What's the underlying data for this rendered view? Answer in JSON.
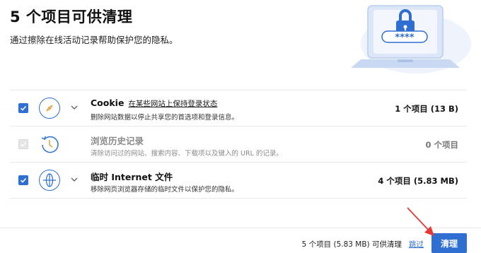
{
  "header": {
    "title": "5 个项目可供清理",
    "subtitle": "通过擦除在线活动记录帮助保护您的隐私。"
  },
  "items": [
    {
      "name": "Cookie",
      "link": "在某些网站上保持登录状态",
      "description": "删除网站数据以停止共享您的首选项和登录信息。",
      "count": "1 个项目 (13 B)",
      "checked": true,
      "enabled": true,
      "icon": "compass-icon"
    },
    {
      "name": "浏览历史记录",
      "link": "",
      "description": "清除访问过的网站、搜索内容、下载项以及键入的 URL 的记录。",
      "count": "0 个项目",
      "checked": false,
      "enabled": false,
      "icon": "history-icon"
    },
    {
      "name": "临时 Internet 文件",
      "link": "",
      "description": "移除网页浏览器存储的临时文件以保护您的隐私。",
      "count": "4 个项目 (5.83 MB)",
      "checked": true,
      "enabled": true,
      "icon": "globe-icon"
    }
  ],
  "footer": {
    "summary": "5 个项目 (5.83 MB) 可供清理",
    "skip_label": "跳过",
    "clean_label": "清理"
  },
  "colors": {
    "accent": "#2f6fd1",
    "arrow": "#e53935"
  },
  "illustration": {
    "password_mask": "****"
  }
}
